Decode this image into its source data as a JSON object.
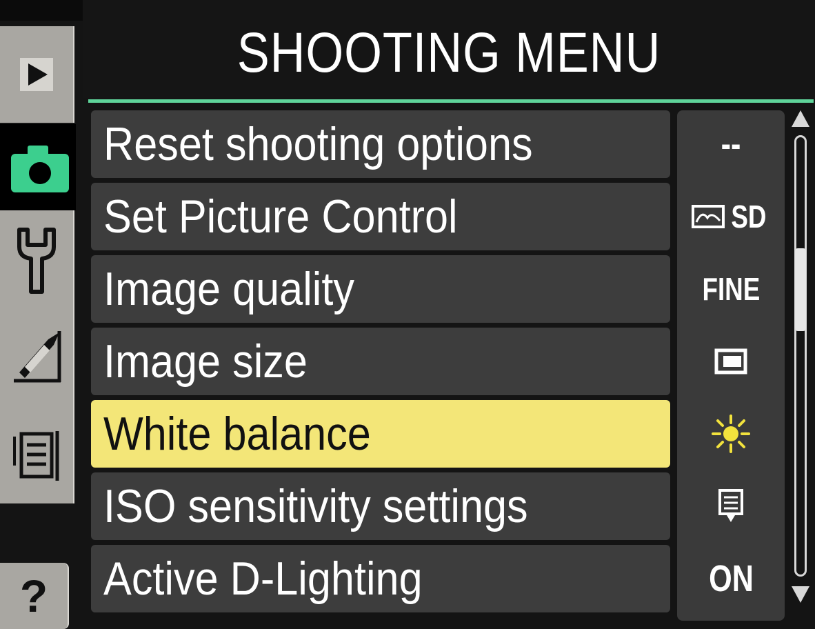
{
  "header": {
    "title": "SHOOTING MENU"
  },
  "tabs": [
    {
      "id": "playback",
      "icon": "play-icon"
    },
    {
      "id": "shooting",
      "icon": "camera-icon",
      "active": true
    },
    {
      "id": "setup",
      "icon": "wrench-icon"
    },
    {
      "id": "retouch",
      "icon": "retouch-brush-icon"
    },
    {
      "id": "recent",
      "icon": "recent-settings-icon"
    },
    {
      "id": "help",
      "icon": "help-icon",
      "label": "?"
    }
  ],
  "menu": {
    "items": [
      {
        "label": "Reset shooting options",
        "value": "--"
      },
      {
        "label": "Set Picture Control",
        "value": "SD"
      },
      {
        "label": "Image quality",
        "value": "FINE"
      },
      {
        "label": "Image size",
        "value": ""
      },
      {
        "label": "White balance",
        "value": "",
        "selected": true
      },
      {
        "label": "ISO sensitivity settings",
        "value": ""
      },
      {
        "label": "Active D-Lighting",
        "value": "ON"
      }
    ]
  },
  "scrollbar": {
    "position_fraction": 0.28
  },
  "colors": {
    "accent_underline": "#5fd49a",
    "active_tab": "#3ccf8e",
    "selected_row": "#f3e678",
    "sun_icon": "#f2e23d"
  }
}
